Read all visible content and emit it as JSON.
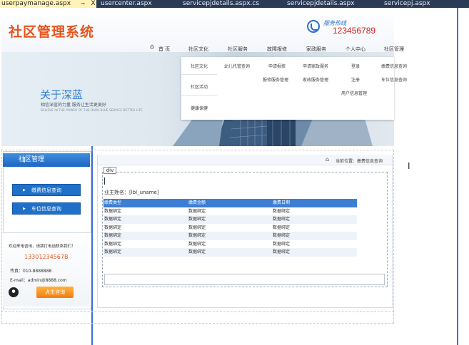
{
  "tabs": [
    {
      "label": "userpaymanage.aspx",
      "active": true
    },
    {
      "label": "usercenter.aspx",
      "active": false
    },
    {
      "label": "servicepjdetails.aspx.cs",
      "active": false
    },
    {
      "label": "servicepjdetails.aspx",
      "active": false
    },
    {
      "label": "servicepj.aspx",
      "active": false
    }
  ],
  "tab_close": "X",
  "tab_pin": "⊸",
  "header": {
    "logo": "社区管理系统",
    "hotline_label": "服务热线",
    "hotline_number": "123456789"
  },
  "nav": {
    "home": "首 页",
    "items": [
      "社区文化",
      "社区服务",
      "故障报修",
      "家政服务",
      "个人中心",
      "社区管理"
    ]
  },
  "dropdown": {
    "columns": [
      [
        "社区文化",
        "社区活动",
        "健康保健"
      ],
      [
        "幼儿托管查询"
      ],
      [
        "申请报修",
        "报修服务管理"
      ],
      [
        "申请家政服务",
        "家政服务管理"
      ],
      [
        "登录",
        "注册",
        "用户信息管理"
      ],
      [
        "缴费信息查询",
        "车位信息查询"
      ]
    ]
  },
  "banner": {
    "title": "关于深蓝",
    "subtitle": "相信深蓝的力量 服务让生活更美好",
    "subtitle_en": "BELIEVE IN THE POWER OF THE DARK BLUE SERVICE BETTER LIFE"
  },
  "sidebar": {
    "title": "社区管理",
    "buttons": [
      "缴费信息查询",
      "车位信息查询"
    ],
    "contact": {
      "intro": "欢迎来电咨询，请拨打电话联系我们！",
      "phone": "13301234567B",
      "fax": "传真：010-8888888",
      "email": "E-mail：admin@8888.com",
      "consult_button": "点击咨询"
    }
  },
  "main": {
    "location": "当前位置：缴费信息查询",
    "div_tag": "div",
    "username_label": "业主姓名：[lbl_uname]",
    "table": {
      "headers": [
        "缴费类型",
        "缴费金额",
        "缴费日期"
      ],
      "rows": [
        [
          "数据绑定",
          "数据绑定",
          "数据绑定"
        ],
        [
          "数据绑定",
          "数据绑定",
          "数据绑定"
        ],
        [
          "数据绑定",
          "数据绑定",
          "数据绑定"
        ],
        [
          "数据绑定",
          "数据绑定",
          "数据绑定"
        ],
        [
          "数据绑定",
          "数据绑定",
          "数据绑定"
        ],
        [
          "数据绑定",
          "数据绑定",
          "数据绑定"
        ]
      ]
    }
  },
  "colors": {
    "accent": "#1f70c8",
    "logo": "#e8541e",
    "hotline": "#d0201b",
    "tabbar": "#2b3a55"
  }
}
